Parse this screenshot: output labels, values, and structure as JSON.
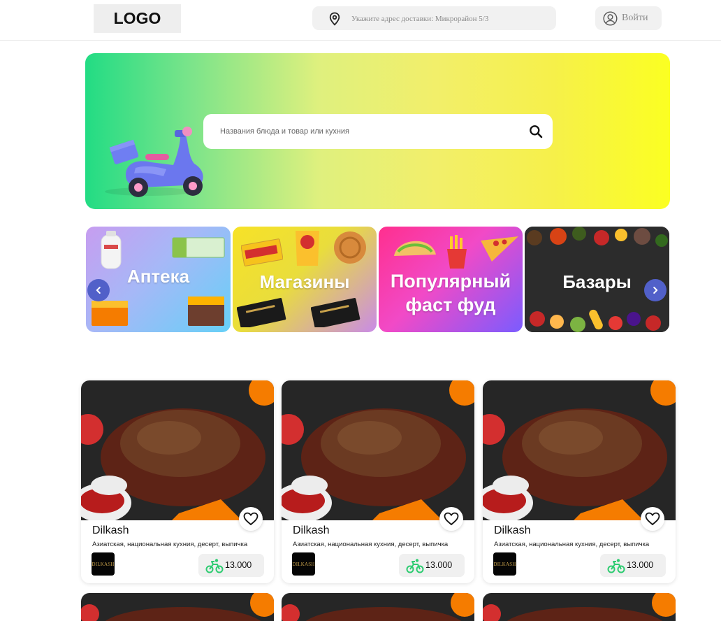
{
  "header": {
    "logo": "LOGO",
    "address_placeholder": "Укажите адрес доставки: Микрорайон 5/3",
    "login_label": "Войти"
  },
  "hero": {
    "search_placeholder": "Названия блюда и товар или кухния"
  },
  "categories": [
    {
      "label": "Аптека"
    },
    {
      "label": "Магазины"
    },
    {
      "label_line1": "Популярный",
      "label_line2": "фаст фуд"
    },
    {
      "label": "Базары"
    }
  ],
  "restaurants": [
    {
      "name": "Dilkash",
      "description": "Азиатская, национальная кухния, десерт, выпичка",
      "brand": "DILKASH",
      "delivery_price": "13.000"
    },
    {
      "name": "Dilkash",
      "description": "Азиатская, национальная кухния, десерт, выпичка",
      "brand": "DILKASH",
      "delivery_price": "13.000"
    },
    {
      "name": "Dilkash",
      "description": "Азиатская, национальная кухния, десерт, выпичка",
      "brand": "DILKASH",
      "delivery_price": "13.000"
    }
  ],
  "colors": {
    "accent_blue": "#5160c9",
    "delivery_green": "#2ecc71",
    "hero_gradient_start": "#22dc84",
    "hero_gradient_end": "#fbff22"
  },
  "icons": [
    "location-pin-icon",
    "user-icon",
    "search-icon",
    "scooter-illustration",
    "chevron-left-icon",
    "chevron-right-icon",
    "heart-icon",
    "delivery-bike-icon"
  ]
}
